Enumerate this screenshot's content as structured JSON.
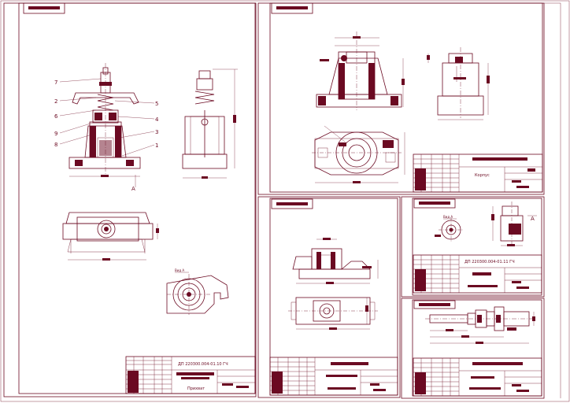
{
  "sheets": [
    {
      "id": "sheet-1",
      "titleblock_code": "ДП 220300.004-01.10 ГЧ",
      "titleblock_name": "Прихват"
    },
    {
      "id": "sheet-2",
      "titleblock_name": "Корпус"
    },
    {
      "id": "sheet-3"
    },
    {
      "id": "sheet-4",
      "titleblock_code": "ДП 220300.004-01.11 ГЧ"
    },
    {
      "id": "sheet-5"
    }
  ],
  "assembly": {
    "part_numbers": [
      "7",
      "2",
      "6",
      "9",
      "8",
      "5",
      "4",
      "3",
      "1"
    ],
    "section_mark": "А",
    "view_label": "Вид А"
  },
  "detail_view": {
    "view_label": "Вид А",
    "section_mark": "А"
  },
  "colors": {
    "line": "#6b0a22",
    "background": "#ffffff",
    "frame": "#6b0a22"
  }
}
